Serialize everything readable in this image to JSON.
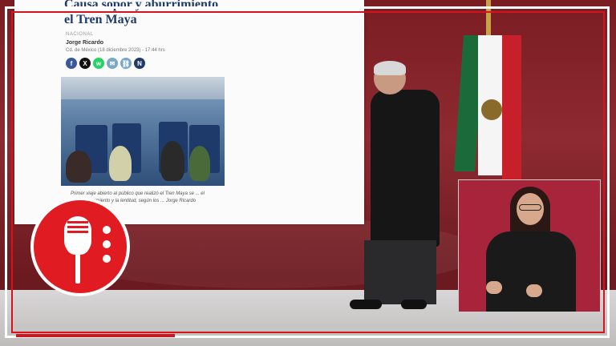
{
  "article": {
    "headline_line1": "Causa sopor y aburrimiento",
    "headline_line2": "el Tren Maya",
    "section": "NACIONAL",
    "author": "Jorge Ricardo",
    "dateline": "Cd. de México (18 diciembre 2023) - 17:44 hrs",
    "caption": "Primer viaje abierto al público que realizó el Tren Maya se ... el calor, aburrimiento y la lentitud, según los ... Jorge Ricardo"
  },
  "share_buttons": [
    {
      "icon": "facebook-icon",
      "glyph": "f",
      "color": "#3b5998"
    },
    {
      "icon": "x-icon",
      "glyph": "X",
      "color": "#111111"
    },
    {
      "icon": "whatsapp-icon",
      "glyph": "w",
      "color": "#25d366"
    },
    {
      "icon": "email-icon",
      "glyph": "✉",
      "color": "#7aa7c7"
    },
    {
      "icon": "link-icon",
      "glyph": "⛓",
      "color": "#7aa7c7"
    },
    {
      "icon": "news-icon",
      "glyph": "N",
      "color": "#1f3a6b"
    }
  ],
  "colors": {
    "accent_red": "#d4141c",
    "stage": "#8e2a31",
    "sign_box": "#a8243a"
  }
}
